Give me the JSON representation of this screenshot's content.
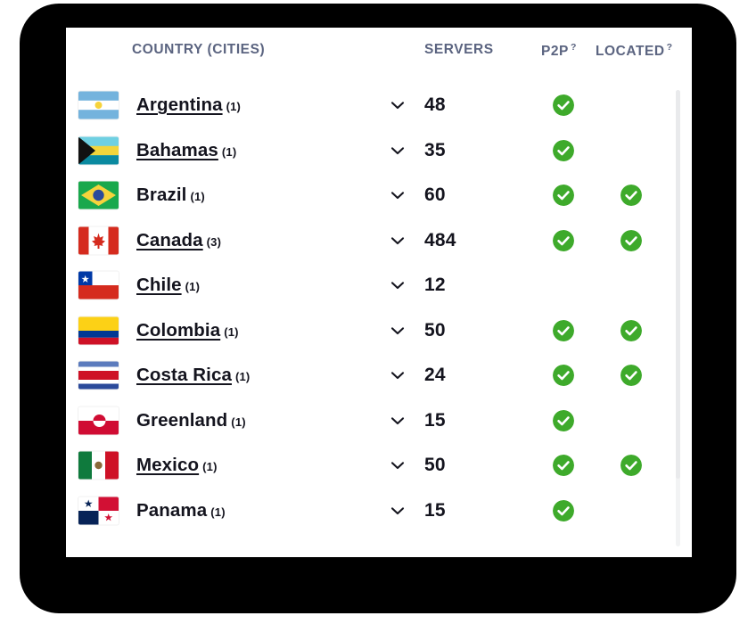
{
  "window": {
    "frame_color": "#000000",
    "card_background": "#ffffff"
  },
  "theme": {
    "header_text_color": "#5b6480",
    "row_text_color": "#14141e",
    "check_green": "#3eaa2b",
    "scrollbar_track": "#f2f3f4"
  },
  "table": {
    "headers": {
      "country": "COUNTRY (CITIES)",
      "servers": "SERVERS",
      "p2p": "P2P",
      "p2p_help": "?",
      "located": "LOCATED",
      "located_help": "?"
    },
    "rows": [
      {
        "flag": "flag-argentina",
        "country": "Argentina",
        "cities": "(1)",
        "underlined": true,
        "servers": "48",
        "p2p": true,
        "located": false,
        "expand_icon": "chevron-down-icon"
      },
      {
        "flag": "flag-bahamas",
        "country": "Bahamas",
        "cities": "(1)",
        "underlined": true,
        "servers": "35",
        "p2p": true,
        "located": false,
        "expand_icon": "chevron-down-icon"
      },
      {
        "flag": "flag-brazil",
        "country": "Brazil",
        "cities": "(1)",
        "underlined": false,
        "servers": "60",
        "p2p": true,
        "located": true,
        "expand_icon": "chevron-down-icon"
      },
      {
        "flag": "flag-canada",
        "country": "Canada",
        "cities": "(3)",
        "underlined": true,
        "servers": "484",
        "p2p": true,
        "located": true,
        "expand_icon": "chevron-down-icon"
      },
      {
        "flag": "flag-chile",
        "country": "Chile",
        "cities": "(1)",
        "underlined": true,
        "servers": "12",
        "p2p": false,
        "located": false,
        "expand_icon": "chevron-down-icon"
      },
      {
        "flag": "flag-colombia",
        "country": "Colombia",
        "cities": "(1)",
        "underlined": true,
        "servers": "50",
        "p2p": true,
        "located": true,
        "expand_icon": "chevron-down-icon"
      },
      {
        "flag": "flag-costa-rica",
        "country": "Costa Rica",
        "cities": "(1)",
        "underlined": true,
        "servers": "24",
        "p2p": true,
        "located": true,
        "expand_icon": "chevron-down-icon"
      },
      {
        "flag": "flag-greenland",
        "country": "Greenland",
        "cities": "(1)",
        "underlined": false,
        "servers": "15",
        "p2p": true,
        "located": false,
        "expand_icon": "chevron-down-icon"
      },
      {
        "flag": "flag-mexico",
        "country": "Mexico",
        "cities": "(1)",
        "underlined": true,
        "servers": "50",
        "p2p": true,
        "located": true,
        "expand_icon": "chevron-down-icon"
      },
      {
        "flag": "flag-panama",
        "country": "Panama",
        "cities": "(1)",
        "underlined": false,
        "servers": "15",
        "p2p": true,
        "located": false,
        "expand_icon": "chevron-down-icon"
      }
    ]
  },
  "scrollbar": {
    "thumb_fraction": 0.82
  }
}
